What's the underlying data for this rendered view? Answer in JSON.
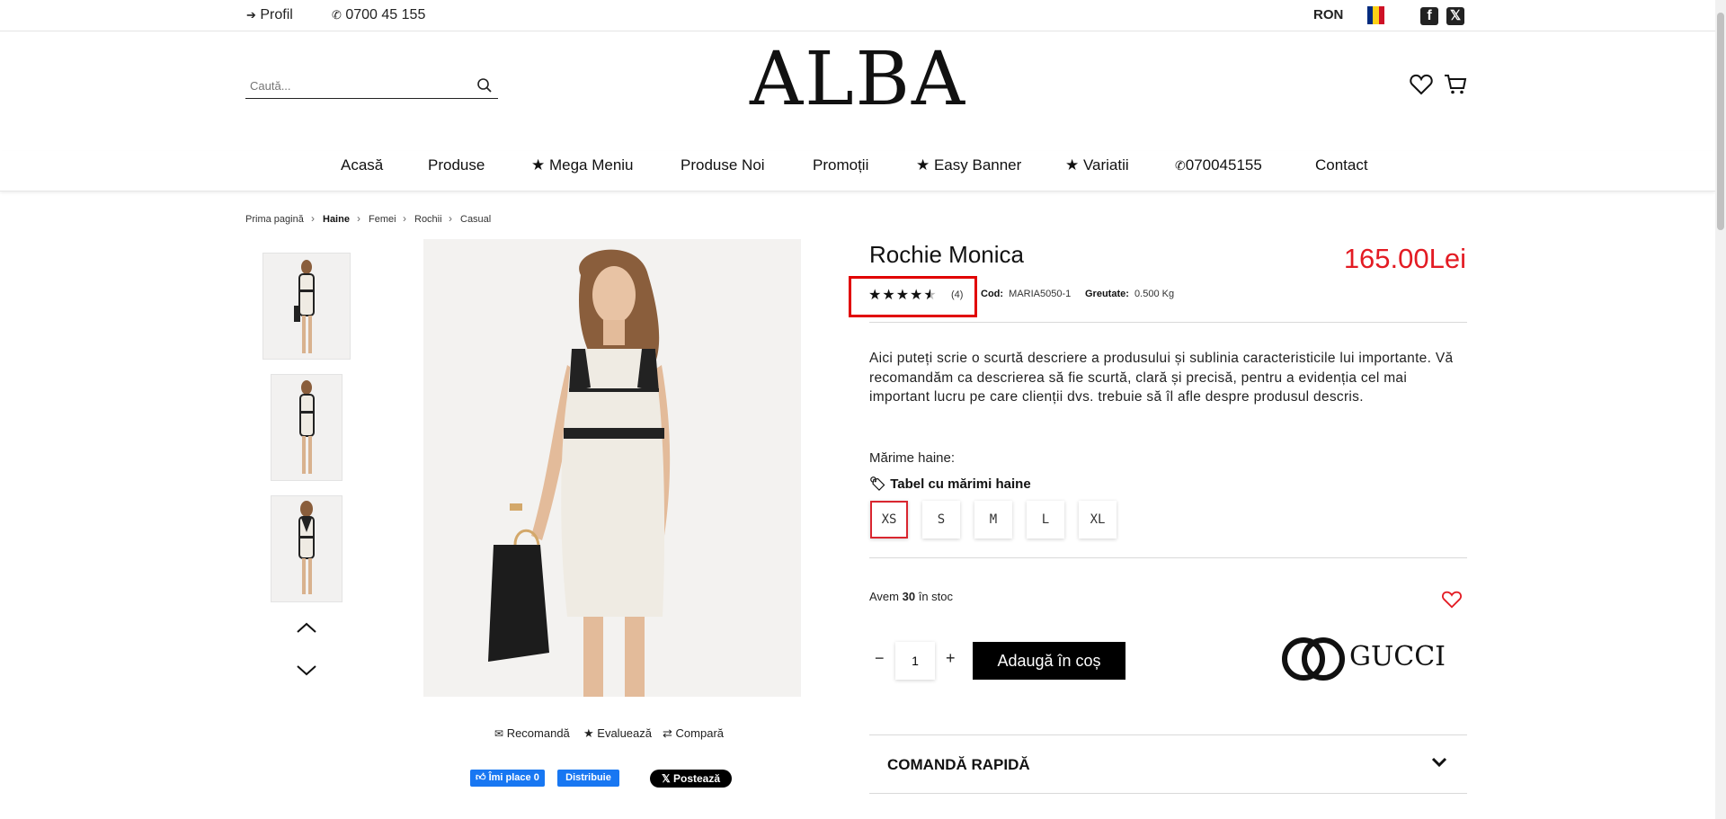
{
  "topbar": {
    "profile_label": "Profil",
    "phone_label": "0700 45 155",
    "currency": "RON",
    "facebook_icon": "facebook-icon",
    "x_icon": "x-twitter-icon"
  },
  "header": {
    "search_placeholder": "Caută...",
    "logo_text": "ALBA"
  },
  "nav": {
    "items": [
      {
        "label": "Acasă"
      },
      {
        "label": "Produse"
      },
      {
        "label": "★ Mega Meniu"
      },
      {
        "label": "Produse Noi"
      },
      {
        "label": "Promoții"
      },
      {
        "label": "★ Easy Banner"
      },
      {
        "label": "★ Variatii"
      },
      {
        "label": "070045155"
      },
      {
        "label": "Contact"
      }
    ]
  },
  "breadcrumb": [
    "Prima pagină",
    "Haine",
    "Femei",
    "Rochii",
    "Casual"
  ],
  "gallery": {
    "share": {
      "recommend": "Recomandă",
      "evaluate": "Evaluează",
      "compare": "Compară"
    },
    "fb_like": "Îmi place 0",
    "fb_share": "Distribuie",
    "x_post": "Postează"
  },
  "product": {
    "title": "Rochie Monica",
    "price": "165.00Lei",
    "rating": 4.5,
    "review_count": "(4)",
    "code_label": "Cod:",
    "code_value": "MARIA5050-1",
    "weight_label": "Greutate:",
    "weight_value": "0.500 Kg",
    "description": "Aici puteți scrie o scurtă descriere a produsului și sublinia caracteristicile lui importante. Vă recomandăm ca descrierea să fie scurtă, clară și precisă, pentru a evidenția cel mai important lucru pe care clienții dvs. trebuie să îl afle despre produsul descris.",
    "size_label": "Mărime haine:",
    "size_table_label": "Tabel cu mărimi haine",
    "sizes": [
      "XS",
      "S",
      "M",
      "L",
      "XL"
    ],
    "selected_size": "XS",
    "stock_prefix": "Avem",
    "stock_count": "30",
    "stock_suffix": "în stoc",
    "quantity": "1",
    "add_to_cart": "Adaugă în coș",
    "brand": "GUCCI",
    "quick_order": "COMANDĂ RAPIDĂ"
  },
  "colors": {
    "accent_red": "#e31b23",
    "highlight_box": "#e10000",
    "button_black": "#000000"
  }
}
